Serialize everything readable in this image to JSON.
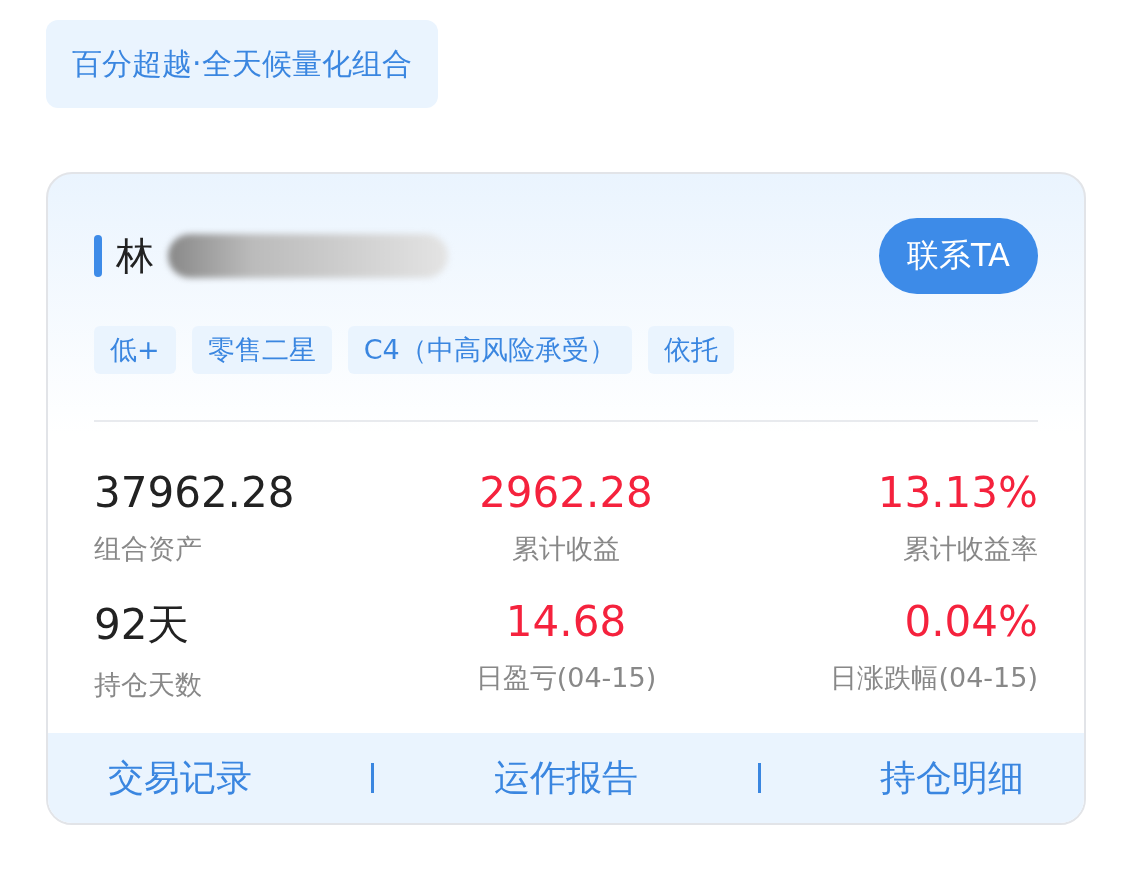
{
  "portfolio_tag": "百分超越·全天候量化组合",
  "advisor": {
    "name": "林",
    "contact_button": "联系TA"
  },
  "tags": [
    "低+",
    "零售二星",
    "C4（中高风险承受）",
    "依托"
  ],
  "stats": [
    {
      "value": "37962.28",
      "label": "组合资产",
      "color": "#222222"
    },
    {
      "value": "2962.28",
      "label": "累计收益",
      "color": "#f5223d"
    },
    {
      "value": "13.13%",
      "label": "累计收益率",
      "color": "#f5223d"
    },
    {
      "value": "92天",
      "label": "持仓天数",
      "color": "#222222"
    },
    {
      "value": "14.68",
      "label": "日盈亏(04-15)",
      "color": "#f5223d"
    },
    {
      "value": "0.04%",
      "label": "日涨跌幅(04-15)",
      "color": "#f5223d"
    }
  ],
  "actions": [
    "交易记录",
    "运作报告",
    "持仓明细"
  ]
}
